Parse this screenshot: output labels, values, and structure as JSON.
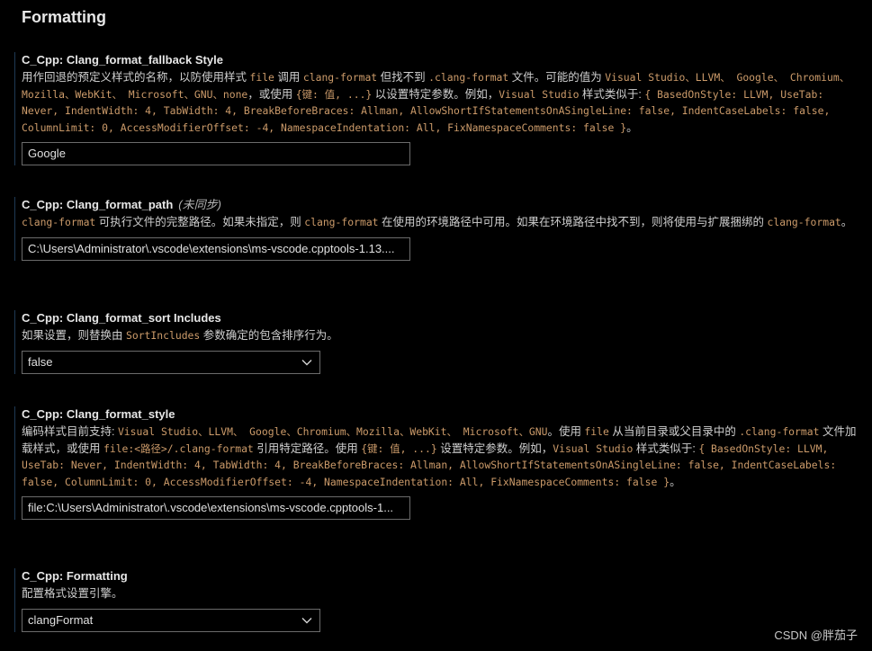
{
  "section": {
    "title": "Formatting"
  },
  "settings": [
    {
      "title": "C_Cpp: Clang_format_fallback Style",
      "description": [
        {
          "t": "text",
          "v": "用作回退的预定义样式的名称，以防使用样式 "
        },
        {
          "t": "code",
          "v": "file"
        },
        {
          "t": "text",
          "v": " 调用 "
        },
        {
          "t": "code",
          "v": "clang-format"
        },
        {
          "t": "text",
          "v": " 但找不到 "
        },
        {
          "t": "code",
          "v": ".clang-format"
        },
        {
          "t": "text",
          "v": " 文件。可能的值为 "
        },
        {
          "t": "code",
          "v": "Visual Studio、LLVM、 Google、 Chromium、Mozilla、WebKit、 Microsoft、GNU、none"
        },
        {
          "t": "text",
          "v": "，或使用 "
        },
        {
          "t": "code",
          "v": "{键: 值, ...}"
        },
        {
          "t": "text",
          "v": " 以设置特定参数。例如，"
        },
        {
          "t": "code",
          "v": "Visual Studio"
        },
        {
          "t": "text",
          "v": " 样式类似于: "
        },
        {
          "t": "code",
          "v": "{ BasedOnStyle: LLVM, UseTab: Never, IndentWidth: 4, TabWidth: 4, BreakBeforeBraces: Allman, AllowShortIfStatementsOnASingleLine: false, IndentCaseLabels: false, ColumnLimit: 0, AccessModifierOffset: -4, NamespaceIndentation: All, FixNamespaceComments: false }"
        },
        {
          "t": "text",
          "v": "。"
        }
      ],
      "control": {
        "type": "text",
        "value": "Google"
      }
    },
    {
      "title": "C_Cpp: Clang_format_path",
      "nosync": "(未同步)",
      "description": [
        {
          "t": "code",
          "v": "clang-format"
        },
        {
          "t": "text",
          "v": " 可执行文件的完整路径。如果未指定，则 "
        },
        {
          "t": "code",
          "v": "clang-format"
        },
        {
          "t": "text",
          "v": " 在使用的环境路径中可用。如果在环境路径中找不到，则将使用与扩展捆绑的 "
        },
        {
          "t": "code",
          "v": "clang-format"
        },
        {
          "t": "text",
          "v": "。"
        }
      ],
      "control": {
        "type": "text",
        "value": "C:\\Users\\Administrator\\.vscode\\extensions\\ms-vscode.cpptools-1.13...."
      }
    },
    {
      "title": "C_Cpp: Clang_format_sort Includes",
      "description": [
        {
          "t": "text",
          "v": "如果设置，则替换由 "
        },
        {
          "t": "code",
          "v": "SortIncludes"
        },
        {
          "t": "text",
          "v": " 参数确定的包含排序行为。"
        }
      ],
      "control": {
        "type": "select",
        "value": "false"
      }
    },
    {
      "title": "C_Cpp: Clang_format_style",
      "description": [
        {
          "t": "text",
          "v": "编码样式目前支持: "
        },
        {
          "t": "code",
          "v": "Visual Studio、LLVM、 Google、Chromium、Mozilla、WebKit、 Microsoft、GNU"
        },
        {
          "t": "text",
          "v": "。使用 "
        },
        {
          "t": "code",
          "v": "file"
        },
        {
          "t": "text",
          "v": " 从当前目录或父目录中的 "
        },
        {
          "t": "code",
          "v": ".clang-format"
        },
        {
          "t": "text",
          "v": " 文件加载样式，或使用 "
        },
        {
          "t": "code",
          "v": "file:<路径>/.clang-format"
        },
        {
          "t": "text",
          "v": " 引用特定路径。使用 "
        },
        {
          "t": "code",
          "v": "{键: 值, ...}"
        },
        {
          "t": "text",
          "v": " 设置特定参数。例如，"
        },
        {
          "t": "code",
          "v": "Visual Studio"
        },
        {
          "t": "text",
          "v": " 样式类似于: "
        },
        {
          "t": "code",
          "v": "{ BasedOnStyle: LLVM, UseTab: Never, IndentWidth: 4, TabWidth: 4, BreakBeforeBraces: Allman, AllowShortIfStatementsOnASingleLine: false, IndentCaseLabels: false, ColumnLimit: 0, AccessModifierOffset: -4, NamespaceIndentation: All, FixNamespaceComments: false }"
        },
        {
          "t": "text",
          "v": "。"
        }
      ],
      "control": {
        "type": "text",
        "value": "file:C:\\Users\\Administrator\\.vscode\\extensions\\ms-vscode.cpptools-1..."
      }
    },
    {
      "title": "C_Cpp: Formatting",
      "description": [
        {
          "t": "text",
          "v": "配置格式设置引擎。"
        }
      ],
      "control": {
        "type": "select",
        "value": "clangFormat"
      }
    }
  ],
  "watermark": "CSDN @胖茄子",
  "icons": {
    "select_arrow": "chevron-down-icon"
  },
  "colors": {
    "background": "#000000",
    "code_text": "#cc9b6a",
    "border": "#6b6b6b"
  }
}
